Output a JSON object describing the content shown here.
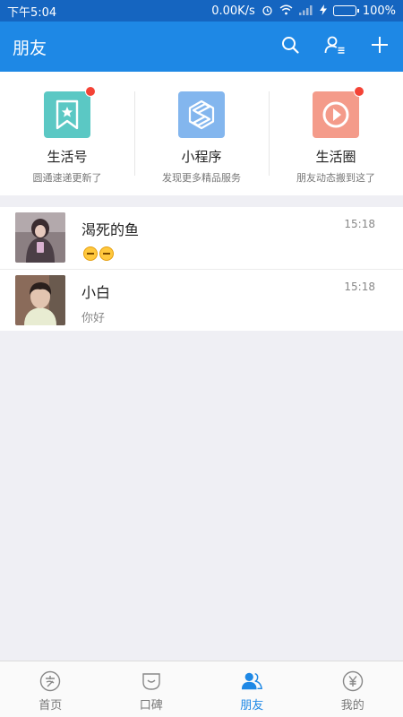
{
  "status_bar": {
    "time": "下午5:04",
    "net_speed": "0.00K/s",
    "battery": "100%",
    "battery_level": 1.0
  },
  "header": {
    "title": "朋友",
    "actions": [
      {
        "icon": "search-icon"
      },
      {
        "icon": "contacts-icon"
      },
      {
        "icon": "add-icon"
      }
    ]
  },
  "entries": [
    {
      "label": "生活号",
      "sub": "圆通速递更新了",
      "icon": "bookmark-star-icon",
      "color": "#5bc8c4",
      "badge": true
    },
    {
      "label": "小程序",
      "sub": "发现更多精品服务",
      "icon": "mini-program-icon",
      "color": "#83b6ee",
      "badge": false
    },
    {
      "label": "生活圈",
      "sub": "朋友动态搬到这了",
      "icon": "life-circle-icon",
      "color": "#f49b8a",
      "badge": true
    }
  ],
  "chats": [
    {
      "name": "渴死的鱼",
      "message": "",
      "emoji_count": 2,
      "time": "15:18"
    },
    {
      "name": "小白",
      "message": "你好",
      "emoji_count": 0,
      "time": "15:18"
    }
  ],
  "tabs": [
    {
      "label": "首页",
      "icon": "home-icon",
      "active": false
    },
    {
      "label": "口碑",
      "icon": "koubei-icon",
      "active": false
    },
    {
      "label": "朋友",
      "icon": "friends-icon",
      "active": true
    },
    {
      "label": "我的",
      "icon": "wallet-icon",
      "active": false
    }
  ],
  "colors": {
    "status_bar": "#1565c0",
    "header": "#1e88e5",
    "accent": "#1e88e5",
    "badge": "#f44336"
  }
}
